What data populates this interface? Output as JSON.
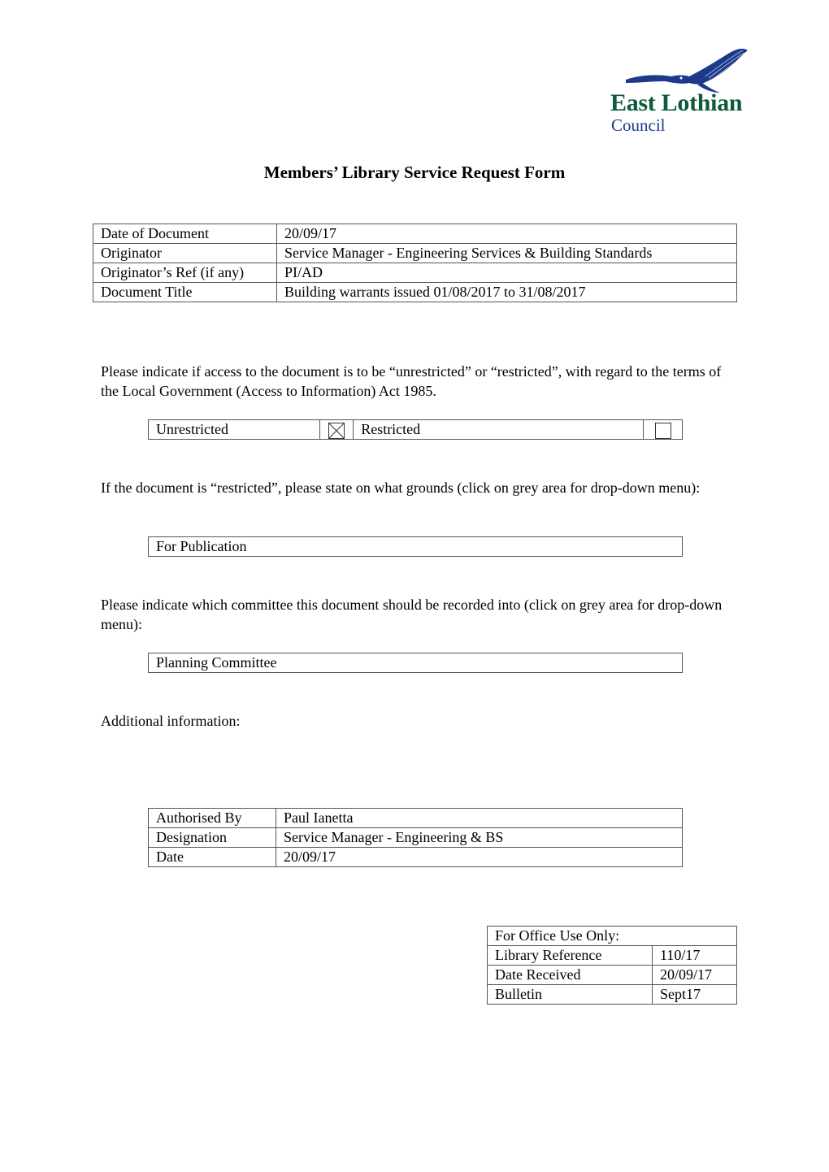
{
  "logo": {
    "icon": "eagle-icon",
    "name": "East Lothian",
    "sub": "Council",
    "colors": {
      "name": "#0e5a3a",
      "sub": "#1c3a8c",
      "bird": "#1c3a8c"
    }
  },
  "title": "Members’ Library Service Request Form",
  "document_details": {
    "rows": [
      {
        "label": "Date of Document",
        "value": "20/09/17"
      },
      {
        "label": "Originator",
        "value": "Service Manager - Engineering Services & Building Standards"
      },
      {
        "label": "Originator’s Ref (if any)",
        "value": "PI/AD"
      },
      {
        "label": "Document Title",
        "value": "Building warrants issued 01/08/2017 to 31/08/2017"
      }
    ]
  },
  "access": {
    "instruction": "Please indicate if access to the document is to be “unrestricted” or “restricted”, with regard to the terms of the Local Government (Access to Information) Act 1985.",
    "options": [
      {
        "label": "Unrestricted",
        "checked": true
      },
      {
        "label": "Restricted",
        "checked": false
      }
    ]
  },
  "grounds": {
    "instruction": "If the document is “restricted”, please state on what grounds (click on grey area for drop-down menu):",
    "selected": "For Publication"
  },
  "committee": {
    "instruction": "Please indicate which committee this document should be recorded into (click on grey area for drop-down menu):",
    "selected": "Planning Committee"
  },
  "additional_info": {
    "label": "Additional information:"
  },
  "authorisation": {
    "rows": [
      {
        "label": "Authorised By",
        "value": "Paul Ianetta"
      },
      {
        "label": "Designation",
        "value": "Service Manager - Engineering & BS"
      },
      {
        "label": "Date",
        "value": "20/09/17"
      }
    ]
  },
  "office_use": {
    "header": "For Office Use Only:",
    "rows": [
      {
        "label": "Library Reference",
        "value": "110/17"
      },
      {
        "label": "Date Received",
        "value": "20/09/17"
      },
      {
        "label": "Bulletin",
        "value": "Sept17"
      }
    ]
  }
}
